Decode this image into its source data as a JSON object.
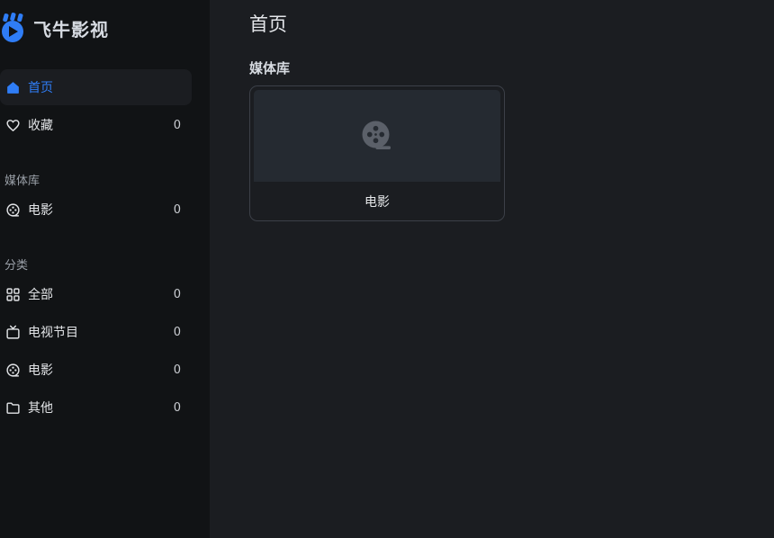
{
  "app": {
    "name": "飞牛影视"
  },
  "colors": {
    "accent": "#2f7df6",
    "sidebar_bg": "#111315",
    "main_bg": "#1b1d21"
  },
  "sidebar": {
    "top_items": [
      {
        "label": "首页",
        "icon": "home-icon",
        "active": true
      },
      {
        "label": "收藏",
        "icon": "heart-icon",
        "count": "0"
      }
    ],
    "library_section": {
      "title": "媒体库",
      "items": [
        {
          "label": "电影",
          "icon": "film-reel-icon",
          "count": "0"
        }
      ]
    },
    "category_section": {
      "title": "分类",
      "items": [
        {
          "label": "全部",
          "icon": "grid-icon",
          "count": "0"
        },
        {
          "label": "电视节目",
          "icon": "tv-icon",
          "count": "0"
        },
        {
          "label": "电影",
          "icon": "film-reel-icon",
          "count": "0"
        },
        {
          "label": "其他",
          "icon": "folder-icon",
          "count": "0"
        }
      ]
    }
  },
  "main": {
    "title": "首页",
    "library_heading": "媒体库",
    "cards": [
      {
        "label": "电影",
        "icon": "film-reel-icon"
      }
    ]
  }
}
